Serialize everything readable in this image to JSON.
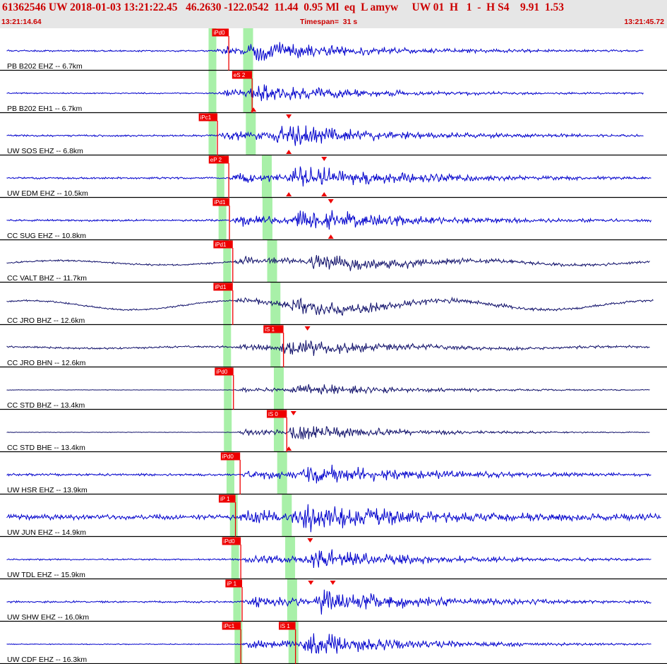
{
  "header": {
    "title": "61362546 UW 2018-01-03 13:21:22.45   46.2630 -122.0542  11.44  0.95 Ml  eq  L amyw     UW 01  H   1  -  H S4    9.91  1.53",
    "start_time": "13:21:14.64",
    "timespan": "Timespan=  31 s",
    "end_time": "13:21:45.72"
  },
  "colors": {
    "header_bg": "#e6e6e6",
    "header_text": "#cc0000",
    "trace_blue": "#0000cc",
    "trace_navy": "#10106a",
    "pick_red": "#ee0000",
    "window_green": "#a8f0a8",
    "separator": "#000000"
  },
  "traces": [
    {
      "label": "PB B202 EHZ -- 6.7km",
      "picks": [
        {
          "label": "iPd0",
          "t": 0.318,
          "w": 0.025
        }
      ],
      "triangles": [],
      "p_win": 0.318,
      "s_win": 0.372,
      "onset": 0.32,
      "s_on": 0.37,
      "end": 0.965,
      "color": "blue",
      "amp": 0.48,
      "noise": 0.05,
      "lf": 0,
      "seed": 1
    },
    {
      "label": "PB B202 EH1 -- 6.7km",
      "picks": [
        {
          "label": "eS 2",
          "t": 0.348,
          "w": 0.03
        }
      ],
      "triangles": [
        {
          "t": 0.38,
          "pos": "bottom"
        }
      ],
      "p_win": 0.318,
      "s_win": 0.372,
      "onset": 0.325,
      "s_on": 0.372,
      "end": 0.965,
      "color": "blue",
      "amp": 0.45,
      "noise": 0.04,
      "lf": 0,
      "seed": 2
    },
    {
      "label": "UW SOS EHZ -- 6.8km",
      "picks": [
        {
          "label": "iPc1",
          "t": 0.298,
          "w": 0.028
        }
      ],
      "triangles": [
        {
          "t": 0.433,
          "pos": "top"
        },
        {
          "t": 0.433,
          "pos": "bottom"
        }
      ],
      "p_win": 0.318,
      "s_win": 0.376,
      "onset": 0.328,
      "s_on": 0.408,
      "end": 0.965,
      "color": "blue",
      "amp": 0.55,
      "noise": 0.06,
      "lf": 0,
      "seed": 3
    },
    {
      "label": "UW EDM EHZ -- 10.5km",
      "picks": [
        {
          "label": "eP 2",
          "t": 0.313,
          "w": 0.03
        }
      ],
      "triangles": [
        {
          "t": 0.433,
          "pos": "bottom"
        },
        {
          "t": 0.486,
          "pos": "top"
        },
        {
          "t": 0.486,
          "pos": "bottom"
        }
      ],
      "p_win": 0.33,
      "s_win": 0.4,
      "onset": 0.343,
      "s_on": 0.433,
      "end": 0.977,
      "color": "blue",
      "amp": 0.62,
      "noise": 0.06,
      "lf": 0,
      "seed": 4
    },
    {
      "label": "CC SUG EHZ -- 10.8km",
      "picks": [
        {
          "label": "iPd1",
          "t": 0.319,
          "w": 0.025
        }
      ],
      "triangles": [
        {
          "t": 0.496,
          "pos": "top"
        },
        {
          "t": 0.496,
          "pos": "bottom"
        }
      ],
      "p_win": 0.333,
      "s_win": 0.401,
      "onset": 0.348,
      "s_on": 0.44,
      "end": 0.977,
      "color": "blue",
      "amp": 0.62,
      "noise": 0.06,
      "lf": 0,
      "seed": 5
    },
    {
      "label": "CC VALT BHZ -- 11.7km",
      "picks": [
        {
          "label": "iPd1",
          "t": 0.32,
          "w": 0.029
        }
      ],
      "triangles": [],
      "p_win": 0.34,
      "s_win": 0.408,
      "onset": 0.35,
      "s_on": 0.455,
      "end": 0.975,
      "color": "navy",
      "amp": 0.5,
      "noise": 0.05,
      "lf": 0.12,
      "seed": 6
    },
    {
      "label": "CC JRO BHZ -- 12.6km",
      "picks": [
        {
          "label": "iPd1",
          "t": 0.32,
          "w": 0.029
        }
      ],
      "triangles": [],
      "p_win": 0.34,
      "s_win": 0.413,
      "onset": 0.35,
      "s_on": 0.43,
      "end": 0.98,
      "color": "navy",
      "amp": 0.45,
      "noise": 0.05,
      "lf": 0.25,
      "seed": 7
    },
    {
      "label": "CC JRO BHN -- 12.6km",
      "picks": [
        {
          "label": "iS 1",
          "t": 0.395,
          "w": 0.03
        }
      ],
      "triangles": [
        {
          "t": 0.461,
          "pos": "top"
        }
      ],
      "p_win": 0.34,
      "s_win": 0.413,
      "onset": 0.352,
      "s_on": 0.42,
      "end": 0.975,
      "color": "navy",
      "amp": 0.4,
      "noise": 0.06,
      "lf": 0.05,
      "seed": 8
    },
    {
      "label": "CC STD BHZ -- 13.4km",
      "picks": [
        {
          "label": "iPd0",
          "t": 0.322,
          "w": 0.028
        }
      ],
      "triangles": [],
      "p_win": 0.341,
      "s_win": 0.418,
      "onset": 0.352,
      "s_on": 0.435,
      "end": 0.975,
      "color": "navy",
      "amp": 0.35,
      "noise": 0.015,
      "lf": 0,
      "seed": 9
    },
    {
      "label": "CC STD BHE -- 13.4km",
      "picks": [
        {
          "label": "iS 0",
          "t": 0.4,
          "w": 0.03
        }
      ],
      "triangles": [
        {
          "t": 0.44,
          "pos": "top"
        },
        {
          "t": 0.433,
          "pos": "bottom"
        }
      ],
      "p_win": 0.341,
      "s_win": 0.418,
      "onset": 0.355,
      "s_on": 0.43,
      "end": 0.975,
      "color": "navy",
      "amp": 0.45,
      "noise": 0.015,
      "lf": 0,
      "seed": 10
    },
    {
      "label": "UW HSR EHZ -- 13.9km",
      "picks": [
        {
          "label": "iPd0",
          "t": 0.331,
          "w": 0.029
        }
      ],
      "triangles": [],
      "p_win": 0.345,
      "s_win": 0.423,
      "onset": 0.36,
      "s_on": 0.45,
      "end": 0.977,
      "color": "blue",
      "amp": 0.55,
      "noise": 0.07,
      "lf": 0,
      "seed": 11
    },
    {
      "label": "UW JUN EHZ -- 14.9km",
      "picks": [
        {
          "label": "iP 1",
          "t": 0.328,
          "w": 0.025
        }
      ],
      "triangles": [],
      "p_win": 0.35,
      "s_win": 0.43,
      "onset": 0.357,
      "s_on": 0.445,
      "end": 0.992,
      "color": "blue",
      "amp": 0.7,
      "noise": 0.16,
      "lf": 0,
      "seed": 12
    },
    {
      "label": "UW TDL EHZ -- 15.9km",
      "picks": [
        {
          "label": "iPd0",
          "t": 0.333,
          "w": 0.028
        }
      ],
      "triangles": [
        {
          "t": 0.465,
          "pos": "top"
        }
      ],
      "p_win": 0.352,
      "s_win": 0.435,
      "onset": 0.362,
      "s_on": 0.46,
      "end": 0.977,
      "color": "blue",
      "amp": 0.55,
      "noise": 0.05,
      "lf": 0,
      "seed": 13
    },
    {
      "label": "UW SHW EHZ -- 16.0km",
      "picks": [
        {
          "label": "iP 1",
          "t": 0.338,
          "w": 0.025
        }
      ],
      "triangles": [
        {
          "t": 0.466,
          "pos": "top"
        },
        {
          "t": 0.499,
          "pos": "top"
        }
      ],
      "p_win": 0.355,
      "s_win": 0.438,
      "onset": 0.365,
      "s_on": 0.47,
      "end": 0.977,
      "color": "blue",
      "amp": 0.65,
      "noise": 0.06,
      "lf": 0,
      "seed": 14
    },
    {
      "label": "UW CDF EHZ -- 16.3km",
      "picks": [
        {
          "label": "iPc1",
          "t": 0.333,
          "w": 0.028
        },
        {
          "label": "iS 1",
          "t": 0.418,
          "w": 0.025
        }
      ],
      "triangles": [],
      "p_win": 0.357,
      "s_win": 0.44,
      "onset": 0.363,
      "s_on": 0.447,
      "end": 0.977,
      "color": "blue",
      "amp": 0.6,
      "noise": 0.03,
      "lf": 0,
      "seed": 15
    }
  ]
}
